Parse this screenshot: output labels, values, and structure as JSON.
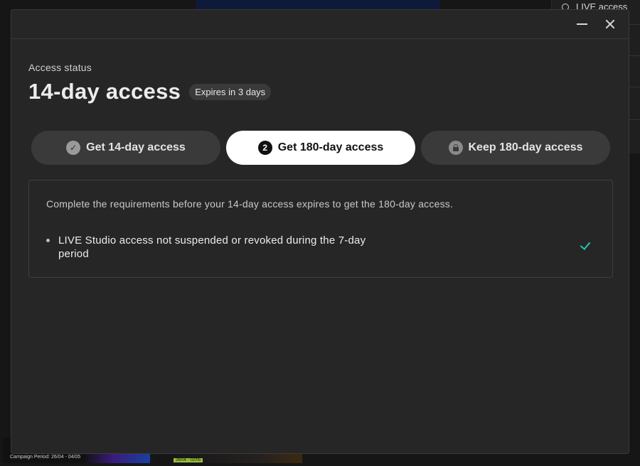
{
  "background": {
    "sidebar_item": "LIVE access",
    "bottom_caption_left": "Campaign Period: 26/04 - 04/05",
    "bottom_caption_right": "26/04 - 02/05"
  },
  "dialog": {
    "eyebrow": "Access status",
    "title": "14-day access",
    "badge": "Expires in 3 days",
    "steps": [
      {
        "label": "Get 14-day access",
        "icon": "check-circle-icon",
        "state": "completed"
      },
      {
        "label": "Get 180-day access",
        "icon": "number-circle-icon",
        "number": "2",
        "state": "active"
      },
      {
        "label": "Keep 180-day access",
        "icon": "lock-icon",
        "state": "locked"
      }
    ],
    "panel": {
      "description": "Complete the requirements before your 14-day access expires to get the 180-day access.",
      "requirements": [
        {
          "text": "LIVE Studio access not suspended or revoked during the 7-day period",
          "status": "met",
          "status_icon": "check-icon"
        }
      ]
    }
  },
  "colors": {
    "accent": "#1ec8b4",
    "dialog_bg": "#262626",
    "active_step_bg": "#ffffff"
  }
}
